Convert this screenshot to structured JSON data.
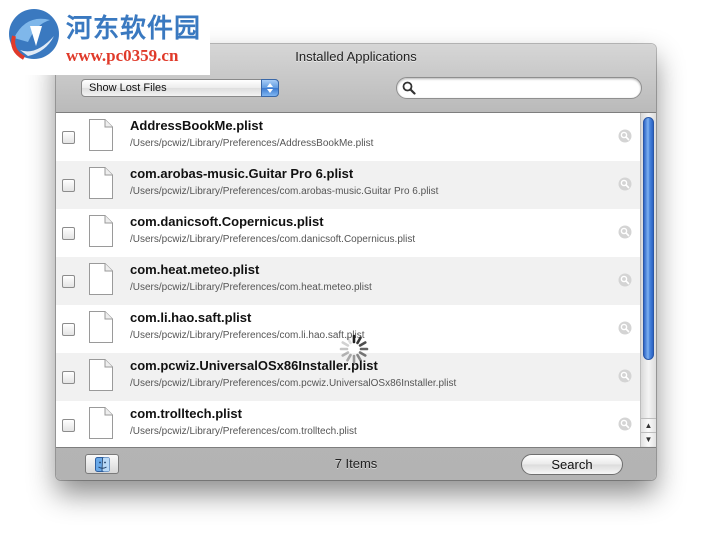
{
  "watermark": {
    "title": "河东软件园",
    "url": "www.pc0359.cn"
  },
  "window": {
    "title": "Installed Applications"
  },
  "toolbar": {
    "filter_popup": "Show Lost Files",
    "search_placeholder": "",
    "search_value": ""
  },
  "files": [
    {
      "name": "AddressBookMe.plist",
      "path": "/Users/pcwiz/Library/Preferences/AddressBookMe.plist",
      "checked": false
    },
    {
      "name": "com.arobas-music.Guitar Pro 6.plist",
      "path": "/Users/pcwiz/Library/Preferences/com.arobas-music.Guitar Pro 6.plist",
      "checked": false
    },
    {
      "name": "com.danicsoft.Copernicus.plist",
      "path": "/Users/pcwiz/Library/Preferences/com.danicsoft.Copernicus.plist",
      "checked": false
    },
    {
      "name": "com.heat.meteo.plist",
      "path": "/Users/pcwiz/Library/Preferences/com.heat.meteo.plist",
      "checked": false
    },
    {
      "name": "com.li.hao.saft.plist",
      "path": "/Users/pcwiz/Library/Preferences/com.li.hao.saft.plist",
      "checked": false
    },
    {
      "name": "com.pcwiz.UniversalOSx86Installer.plist",
      "path": "/Users/pcwiz/Library/Preferences/com.pcwiz.UniversalOSx86Installer.plist",
      "checked": false
    },
    {
      "name": "com.trolltech.plist",
      "path": "/Users/pcwiz/Library/Preferences/com.trolltech.plist",
      "checked": false
    }
  ],
  "scrollbar": {
    "up_arrow": "▲",
    "down_arrow": "▼"
  },
  "statusbar": {
    "item_count": "7 Items",
    "search_button": "Search"
  },
  "icons": {
    "filter_popup_arrows": "up-down-arrows-icon",
    "search_field": "magnifier-icon",
    "file": "document-icon",
    "reveal": "magnifier-circle-icon",
    "loading": "spinner-icon",
    "finder": "finder-icon"
  },
  "colors": {
    "accent": "#3b7ad1",
    "row_alt": "#f1f1f1",
    "watermark_blue": "#3a79c0",
    "watermark_red": "#e03a2a"
  }
}
